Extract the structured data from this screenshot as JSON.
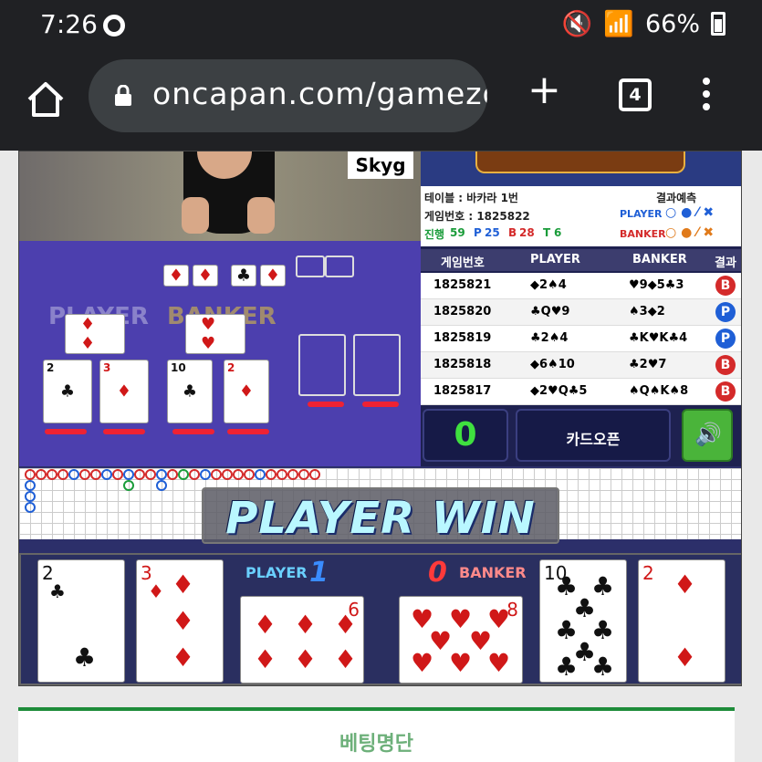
{
  "status": {
    "time": "7:26",
    "battery": "66%",
    "signal_icons": [
      "mute-icon",
      "wifi-icon",
      "signal-icon"
    ]
  },
  "browser": {
    "url": "oncapan.com/gamezo",
    "tab_count": "4"
  },
  "table": {
    "brand": "Skyg",
    "player_word": "PLAYER",
    "banker_word": "BANKER"
  },
  "info": {
    "table_label": "테이블 : 바카라 1번",
    "game_no_label": "게임번호 : 1825822",
    "predict_label": "결과예측",
    "progress_label": "진행",
    "progress_count": "59",
    "p_label": "P",
    "p_count": "25",
    "b_label": "B",
    "b_count": "28",
    "t_label": "T",
    "t_count": "6",
    "player_pred": "PLAYER",
    "banker_pred": "BANKER"
  },
  "history": {
    "headers": [
      "게임번호",
      "PLAYER",
      "BANKER",
      "결과"
    ],
    "rows": [
      {
        "no": "1825821",
        "player": "◆2♠4",
        "banker": "♥9◆5♣3",
        "result": "B",
        "color": "#d42a2a"
      },
      {
        "no": "1825820",
        "player": "♣Q♥9",
        "banker": "♠3◆2",
        "result": "P",
        "color": "#1f5fd6"
      },
      {
        "no": "1825819",
        "player": "♣2♠4",
        "banker": "♣K♥K♣4",
        "result": "P",
        "color": "#1f5fd6"
      },
      {
        "no": "1825818",
        "player": "◆6♠10",
        "banker": "♣2♥7",
        "result": "B",
        "color": "#d42a2a"
      },
      {
        "no": "1825817",
        "player": "◆2♥Q♣5",
        "banker": "♠Q♠K♠8",
        "result": "B",
        "color": "#d42a2a"
      }
    ]
  },
  "controls": {
    "timer": "0",
    "open_label": "카드오픈"
  },
  "result": {
    "banner": "PLAYER WIN",
    "player_label": "PLAYER",
    "player_score": "1",
    "banker_label": "BANKER",
    "banker_score": "0"
  },
  "cards": {
    "player": [
      {
        "rank": "2",
        "suit": "♣"
      },
      {
        "rank": "3",
        "suit": "♦"
      },
      {
        "rank": "6",
        "suit": "♦"
      }
    ],
    "banker": [
      {
        "rank": "8",
        "suit": "♥"
      },
      {
        "rank": "10",
        "suit": "♣"
      },
      {
        "rank": "2",
        "suit": "♦"
      }
    ]
  },
  "footer": {
    "title": "베팅명단"
  },
  "colors": {
    "player_blue": "#1f5fd6",
    "banker_red": "#d42a2a",
    "tie_green": "#1a9c3a",
    "accent_green": "#1e8c3a"
  }
}
